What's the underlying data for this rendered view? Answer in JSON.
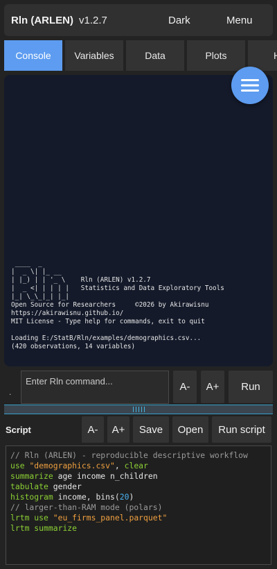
{
  "header": {
    "app_name": "Rln (ARLEN)",
    "version": "v1.2.7",
    "theme_label": "Dark",
    "menu_label": "Menu"
  },
  "tabs": [
    {
      "label": "Console",
      "active": true
    },
    {
      "label": "Variables",
      "active": false
    },
    {
      "label": "Data",
      "active": false
    },
    {
      "label": "Plots",
      "active": false
    },
    {
      "label": "H",
      "active": false
    }
  ],
  "console": {
    "lines": [
      " ____  _",
      "|  _ \\| |_ __",
      "| |_) | | '_ \\    Rln (ARLEN) v1.2.7",
      "|  _ <| | | | |   Statistics and Data Exploratory Tools",
      "|_| \\_\\_|_| |_|",
      "Open Source for Researchers     ©2026 by Akirawisnu",
      "https://akirawisnu.github.io/",
      "MIT License - Type help for commands, exit to quit",
      "",
      "Loading E:/StatB/Rln/examples/demographics.csv...",
      "(420 observations, 14 variables)"
    ]
  },
  "command": {
    "prompt": ".",
    "placeholder": "Enter Rln command...",
    "decrease_font": "A-",
    "increase_font": "A+",
    "run": "Run"
  },
  "script": {
    "label": "Script",
    "decrease_font": "A-",
    "increase_font": "A+",
    "save": "Save",
    "open": "Open",
    "run_script": "Run script"
  },
  "editor": {
    "lines": [
      [
        {
          "t": "// Rln (ARLEN) - reproducible descriptive workflow",
          "c": "comment"
        }
      ],
      [
        {
          "t": "use",
          "c": "kw"
        },
        {
          "t": " "
        },
        {
          "t": "\"demographics.csv\"",
          "c": "str"
        },
        {
          "t": ", "
        },
        {
          "t": "clear",
          "c": "kw"
        }
      ],
      [
        {
          "t": "summarize",
          "c": "kw"
        },
        {
          "t": " age income n_children"
        }
      ],
      [
        {
          "t": "tabulate",
          "c": "kw"
        },
        {
          "t": " gender"
        }
      ],
      [
        {
          "t": "histogram",
          "c": "kw"
        },
        {
          "t": " income, bins("
        },
        {
          "t": "20",
          "c": "num"
        },
        {
          "t": ")"
        }
      ],
      [
        {
          "t": "// larger-than-RAM mode (polars)",
          "c": "comment"
        }
      ],
      [
        {
          "t": "lrtm",
          "c": "kw"
        },
        {
          "t": " "
        },
        {
          "t": "use",
          "c": "kw"
        },
        {
          "t": " "
        },
        {
          "t": "\"eu_firms_panel.parquet\"",
          "c": "str"
        }
      ],
      [
        {
          "t": "lrtm",
          "c": "kw"
        },
        {
          "t": " "
        },
        {
          "t": "summarize",
          "c": "kw"
        }
      ]
    ]
  },
  "colors": {
    "accent": "#5d9cf0",
    "background": "#232323",
    "console_bg": "#141a2a",
    "keyword": "#8cd034",
    "string": "#f0a040",
    "number": "#4ab0f0",
    "comment": "#9a9a9a"
  },
  "icons": {
    "fab": "hamburger-menu-icon",
    "splitter": "drag-grip-icon"
  }
}
